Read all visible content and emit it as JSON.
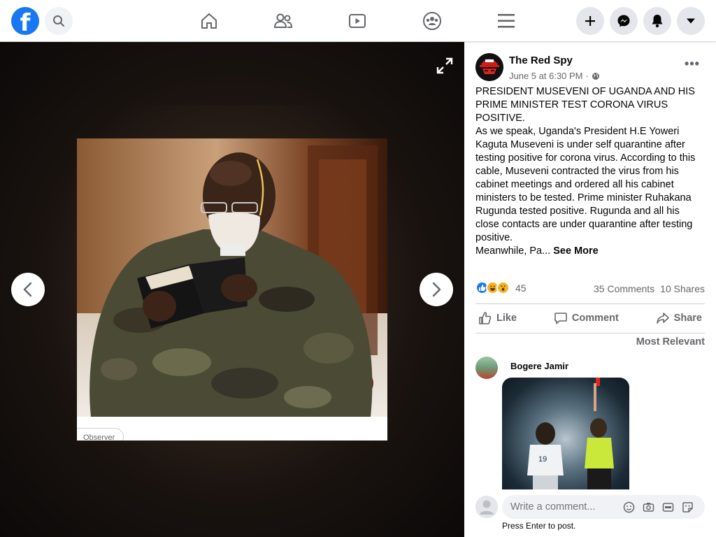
{
  "topbar": {
    "logo_letter": "f",
    "icons": [
      "facebook-logo",
      "search-icon",
      "home-icon",
      "friends-icon",
      "watch-icon",
      "groups-icon",
      "menu-icon",
      "create-plus-icon",
      "messenger-icon",
      "notifications-bell-icon",
      "account-dropdown-icon"
    ]
  },
  "viewer": {
    "photo_tag": "Observer",
    "icons": [
      "expand-icon",
      "previous-arrow-icon",
      "next-arrow-icon"
    ]
  },
  "post": {
    "page_name": "The Red Spy",
    "timestamp": "June 5 at 6:30 PM",
    "separator": "·",
    "headline_lines": [
      "PRESIDENT MUSEVENI OF UGANDA AND HIS",
      "PRIME MINISTER TEST CORONA VIRUS",
      "POSITIVE."
    ],
    "body_lines": [
      "As we speak, Uganda's President H.E Yoweri",
      "Kaguta Museveni is under self quarantine after",
      "testing positive for corona virus. According to this",
      "cable, Museveni contracted the virus from his",
      "cabinet meetings and ordered all his cabinet",
      "ministers to be tested. Prime minister Ruhakana",
      "Rugunda tested positive. Rugunda and all his",
      "close contacts are under quarantine after testing",
      "positive."
    ],
    "truncated_line": "Meanwhile, Pa...",
    "see_more": "See More",
    "reaction_count": "45",
    "comments_count": "35 Comments",
    "shares_count": "10 Shares",
    "actions": {
      "like": "Like",
      "comment": "Comment",
      "share": "Share"
    },
    "sort_label": "Most Relevant"
  },
  "comments": [
    {
      "author": "Bogere Jamir"
    }
  ],
  "composer": {
    "placeholder": "Write a comment...",
    "hint": "Press Enter to post."
  },
  "colors": {
    "brand_blue": "#1877f2",
    "secondary_text": "#65676b",
    "button_gray": "#e4e6eb"
  }
}
